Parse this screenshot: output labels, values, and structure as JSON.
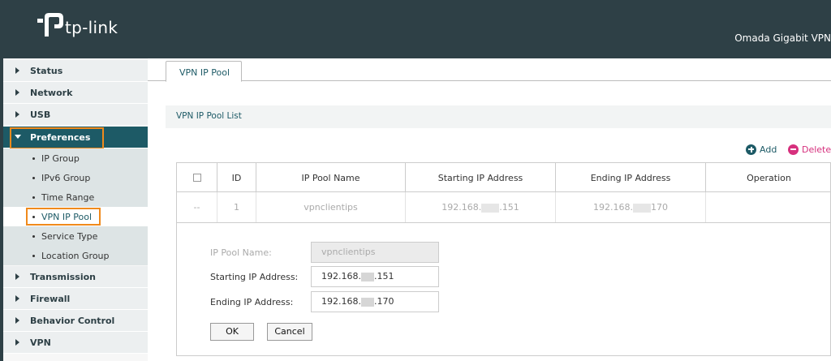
{
  "header": {
    "brand": "tp-link",
    "title": "Omada Gigabit VPN"
  },
  "sidebar": {
    "items": [
      {
        "label": "Status"
      },
      {
        "label": "Network"
      },
      {
        "label": "USB"
      },
      {
        "label": "Preferences"
      },
      {
        "label": "Transmission"
      },
      {
        "label": "Firewall"
      },
      {
        "label": "Behavior Control"
      },
      {
        "label": "VPN"
      }
    ],
    "sub_items": [
      {
        "label": "IP Group"
      },
      {
        "label": "IPv6 Group"
      },
      {
        "label": "Time Range"
      },
      {
        "label": "VPN IP Pool"
      },
      {
        "label": "Service Type"
      },
      {
        "label": "Location Group"
      }
    ]
  },
  "tabs": [
    {
      "label": "VPN IP Pool"
    }
  ],
  "section": {
    "title": "VPN IP Pool List"
  },
  "actions": {
    "add": "Add",
    "delete": "Delete"
  },
  "table": {
    "headers": [
      "",
      "ID",
      "IP Pool Name",
      "Starting IP Address",
      "Ending IP Address",
      "Operation"
    ],
    "rows": [
      {
        "check": "--",
        "id": "1",
        "name": "vpnclientips",
        "start_prefix": "192.168.",
        "start_suffix": ".151",
        "end_prefix": "192.168.",
        "end_suffix": "170",
        "operation": ""
      }
    ]
  },
  "form": {
    "name_label": "IP Pool Name:",
    "name_value": "vpnclientips",
    "start_label": "Starting IP Address:",
    "start_prefix": "192.168.",
    "start_suffix": ".151",
    "end_label": "Ending IP Address:",
    "end_prefix": "192.168.",
    "end_suffix": ".170",
    "ok": "OK",
    "cancel": "Cancel"
  },
  "colors": {
    "header_bg": "#2e4046",
    "accent": "#1d5a66",
    "highlight": "#f08a1c",
    "add": "#1d5a66",
    "delete": "#d6307d"
  }
}
